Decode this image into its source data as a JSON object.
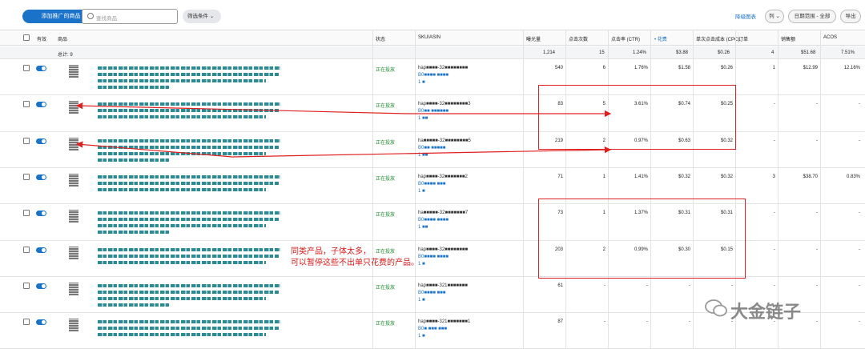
{
  "toolbar": {
    "add_button": "添加推广的商品",
    "search_placeholder": "查找商品",
    "filter_label": "筛选条件",
    "filter_icon": "chevron-down-icon",
    "right_link": "降级图表",
    "column_button": "列",
    "date_range": "日期范围 - 全部",
    "export": "导出"
  },
  "columns": {
    "active": "有效",
    "product": "商品",
    "status": "状态",
    "sku": "SKU/ASIN",
    "impressions": "曝光量",
    "clicks": "点击次数",
    "ctr": "点击率 (CTR)",
    "spend": "• 花费",
    "cpc": "单次点击成本 (CPC)",
    "orders": "订单",
    "sales": "销售额",
    "acos": "ACOS"
  },
  "totals": {
    "label": "总计: 9",
    "impressions": "1,214",
    "clicks": "15",
    "ctr": "1.24%",
    "spend": "$3.88",
    "cpc": "$0.26",
    "orders": "4",
    "sales": "$51.68",
    "acos": "7.51%"
  },
  "rows": [
    {
      "status": "正在投放",
      "sku": "hap■■■■-32■■■■■■■■",
      "asin": "B0■■■■ ■■■■",
      "count": "1 ■",
      "impressions": "540",
      "clicks": "6",
      "ctr": "1.76%",
      "spend": "$1.58",
      "cpc": "$0.26",
      "orders": "1",
      "sales": "$12.99",
      "acos": "12.16%"
    },
    {
      "status": "正在投放",
      "sku": "hap■■■■-32■■■■■■■■3",
      "asin": "B0■■ ■■■■■■",
      "count": "1 ■■",
      "impressions": "83",
      "clicks": "5",
      "ctr": "3.61%",
      "spend": "$0.74",
      "cpc": "$0.25",
      "orders": "-",
      "sales": "-",
      "acos": "-"
    },
    {
      "status": "正在投放",
      "sku": "ha■■■■■-32■■■■■■■■5",
      "asin": "B0■■ ■■■■■",
      "count": "1 ■■",
      "impressions": "219",
      "clicks": "2",
      "ctr": "0.97%",
      "spend": "$0.63",
      "cpc": "$0.32",
      "orders": "-",
      "sales": "-",
      "acos": "-"
    },
    {
      "status": "正在投放",
      "sku": "hap■■■■-32■■■■■■■2",
      "asin": "B0■■■■ ■■■",
      "count": "1 ■",
      "impressions": "71",
      "clicks": "1",
      "ctr": "1.41%",
      "spend": "$0.32",
      "cpc": "$0.32",
      "orders": "3",
      "sales": "$38.70",
      "acos": "0.83%"
    },
    {
      "status": "正在投放",
      "sku": "ha■■■■■-32■■■■■■■7",
      "asin": "B0■■■■ ■■■■",
      "count": "1 ■■",
      "impressions": "73",
      "clicks": "1",
      "ctr": "1.37%",
      "spend": "$0.31",
      "cpc": "$0.31",
      "orders": "-",
      "sales": "-",
      "acos": "-"
    },
    {
      "status": "正在投放",
      "sku": "hap■■■■-32■■■■■■■■",
      "asin": "B0■■■■ ■■■■",
      "count": "1 ■",
      "impressions": "203",
      "clicks": "2",
      "ctr": "0.99%",
      "spend": "$0.30",
      "cpc": "$0.15",
      "orders": "-",
      "sales": "-",
      "acos": "-"
    },
    {
      "status": "正在投放",
      "sku": "hap■■■■-321■■■■■■■",
      "asin": "B0■■■■ ■■■",
      "count": "1 ■",
      "impressions": "61",
      "clicks": "-",
      "ctr": "-",
      "spend": "-",
      "cpc": "-",
      "orders": "-",
      "sales": "-",
      "acos": "-"
    },
    {
      "status": "正在投放",
      "sku": "hap■■■■-321■■■■■■■1",
      "asin": "B0■ ■■■ ■■■",
      "count": "1 ■",
      "impressions": "87",
      "clicks": "-",
      "ctr": "-",
      "spend": "-",
      "cpc": "-",
      "orders": "-",
      "sales": "-",
      "acos": "-"
    }
  ],
  "annotation": {
    "line1": "同类产品，子体太多，",
    "line2": "可以暂停这些不出单只花费的产品。"
  },
  "watermark": {
    "text": "大金链子",
    "icon": "wechat-icon"
  },
  "colors": {
    "accent": "#1a73c9",
    "status_green": "#1a8a2a",
    "annotation_red": "#e02020"
  }
}
